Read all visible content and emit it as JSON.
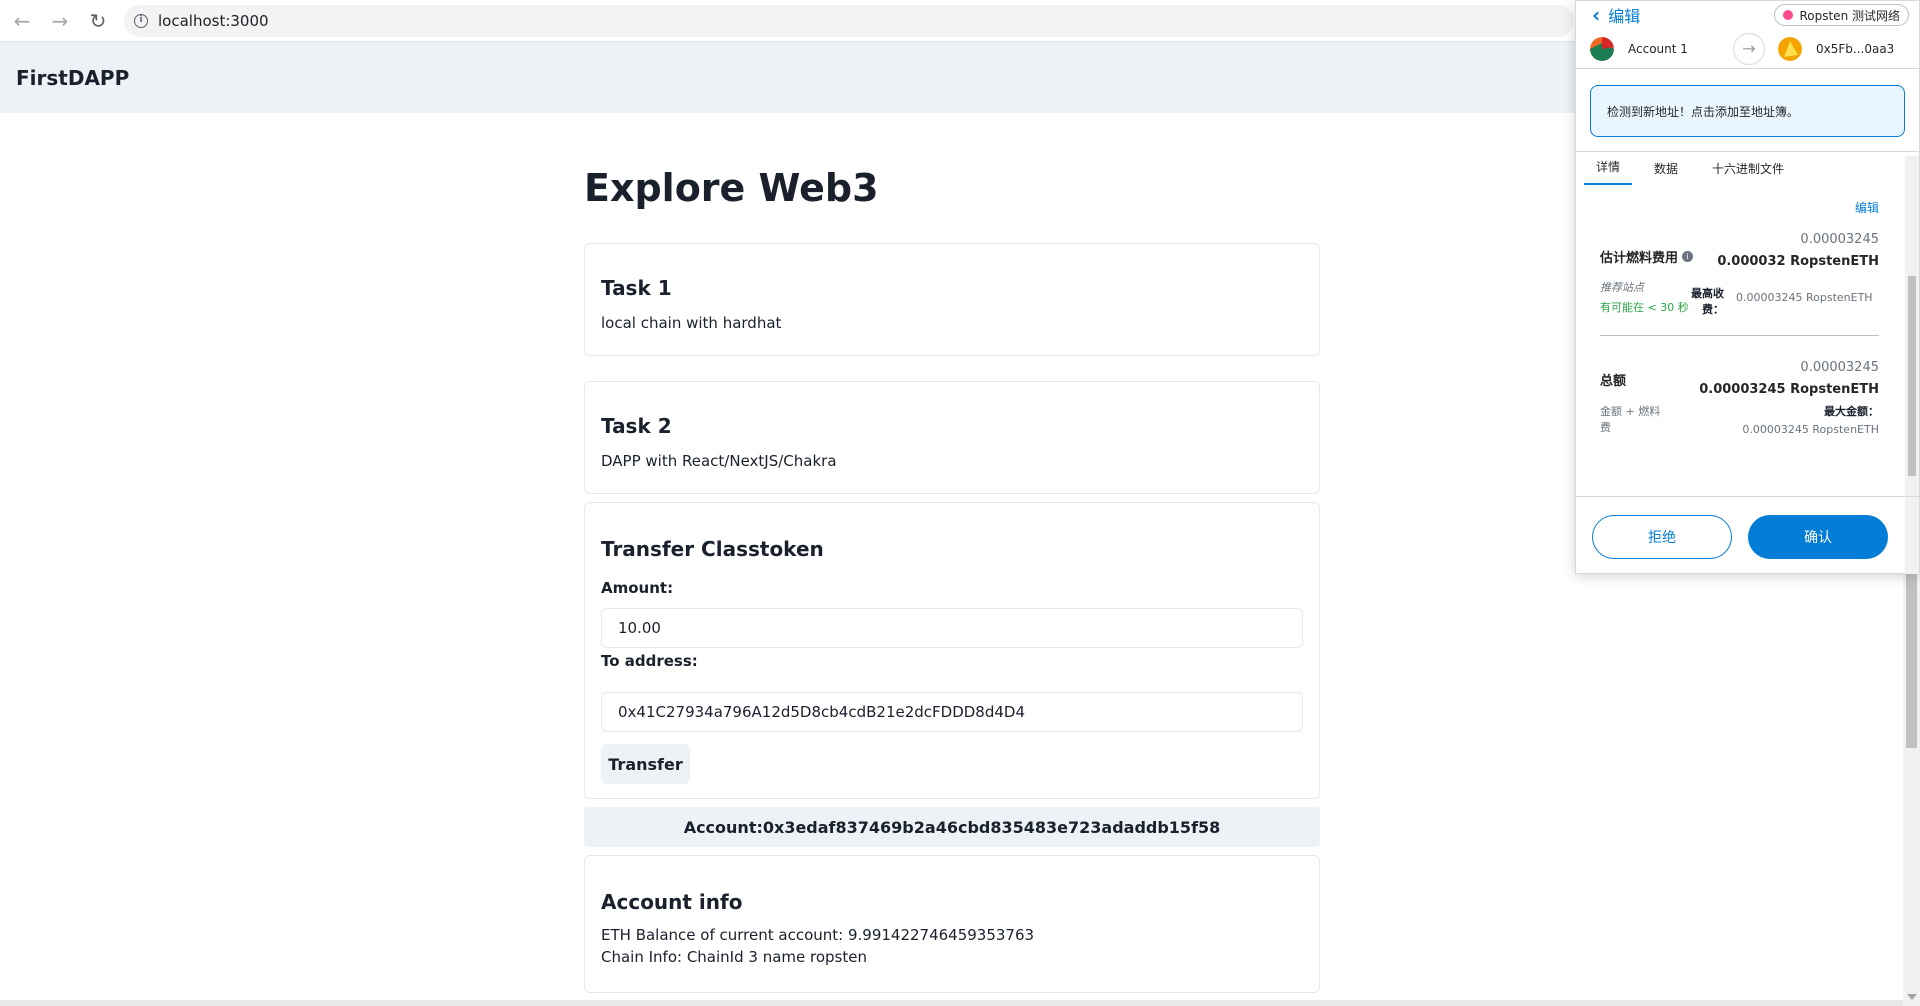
{
  "browser": {
    "url": "localhost:3000",
    "back_icon": "arrow-left-icon",
    "forward_icon": "arrow-right-icon",
    "reload_icon": "reload-icon"
  },
  "app": {
    "title": "FirstDAPP"
  },
  "main": {
    "heading": "Explore Web3",
    "task1": {
      "title": "Task 1",
      "text": "local chain with hardhat"
    },
    "task2": {
      "title": "Task 2",
      "text": "DAPP with React/NextJS/Chakra"
    },
    "transfer": {
      "title": "Transfer Classtoken",
      "amount_label": "Amount:",
      "amount_value": "10.00",
      "to_label": "To address:",
      "to_value": "0x41C27934a796A12d5D8cb4cdB21e2dcFDDD8d4D4",
      "button": "Transfer"
    },
    "account_bar": "Account:0x3edaf837469b2a46cbd835483e723adaddb15f58",
    "account_info": {
      "title": "Account info",
      "balance": "ETH Balance of current account: 9.991422746459353763",
      "chain": "Chain Info: ChainId 3 name ropsten"
    }
  },
  "metamask": {
    "back_label": "编辑",
    "network": "Ropsten 测试网络",
    "from_account": "Account 1",
    "to_address": "0x5Fb...0aa3",
    "alert": "检测到新地址！点击添加至地址簿。",
    "tabs": [
      "详情",
      "数据",
      "十六进制文件"
    ],
    "edit_link": "编辑",
    "gas": {
      "label": "估计燃料费用",
      "value_top": "0.00003245",
      "value_strong": "0.000032 RopstenETH",
      "site_suggested": "推荐站点",
      "likely": "有可能在 < 30 秒",
      "max_fee_label": "最高收费：",
      "max_fee_value": "0.00003245 RopstenETH"
    },
    "total": {
      "label": "总额",
      "value_top": "0.00003245",
      "value_strong": "0.00003245 RopstenETH",
      "sub_label": "金额 + 燃料费",
      "max_amount_label": "最大金额：",
      "max_amount_value": "0.00003245 RopstenETH"
    },
    "reject": "拒绝",
    "confirm": "确认",
    "colors": {
      "primary": "#037dd6",
      "network_dot": "#ff4a8d",
      "success": "#28a745"
    }
  }
}
